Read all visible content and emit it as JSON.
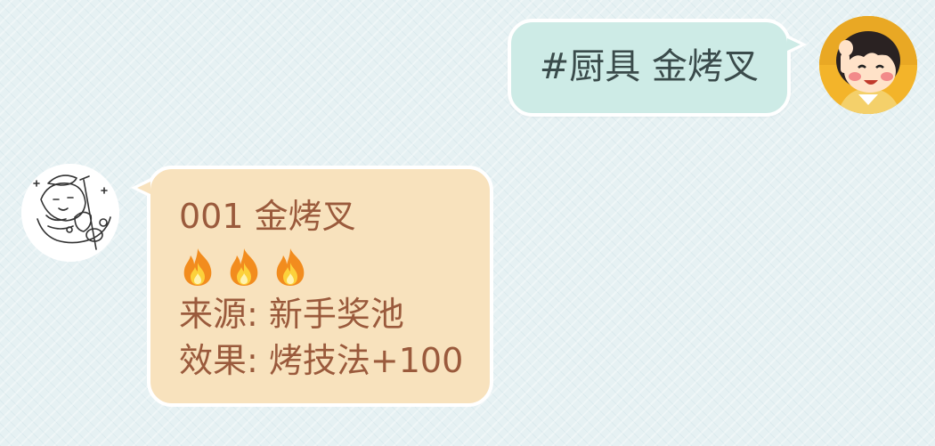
{
  "messages": {
    "outgoing": {
      "text": "#厨具 金烤叉"
    },
    "incoming": {
      "title": "001 金烤叉",
      "rating_icons": [
        "fire-icon",
        "fire-icon",
        "fire-icon"
      ],
      "source": "来源: 新手奖池",
      "effect": "效果: 烤技法+100"
    }
  },
  "colors": {
    "background": "#e6f1f3",
    "outgoing_bubble": "#cdebe6",
    "outgoing_text": "#3a4b4b",
    "incoming_bubble": "#f8e2bd",
    "incoming_text": "#9a5a3c",
    "bubble_border": "#ffffff"
  }
}
